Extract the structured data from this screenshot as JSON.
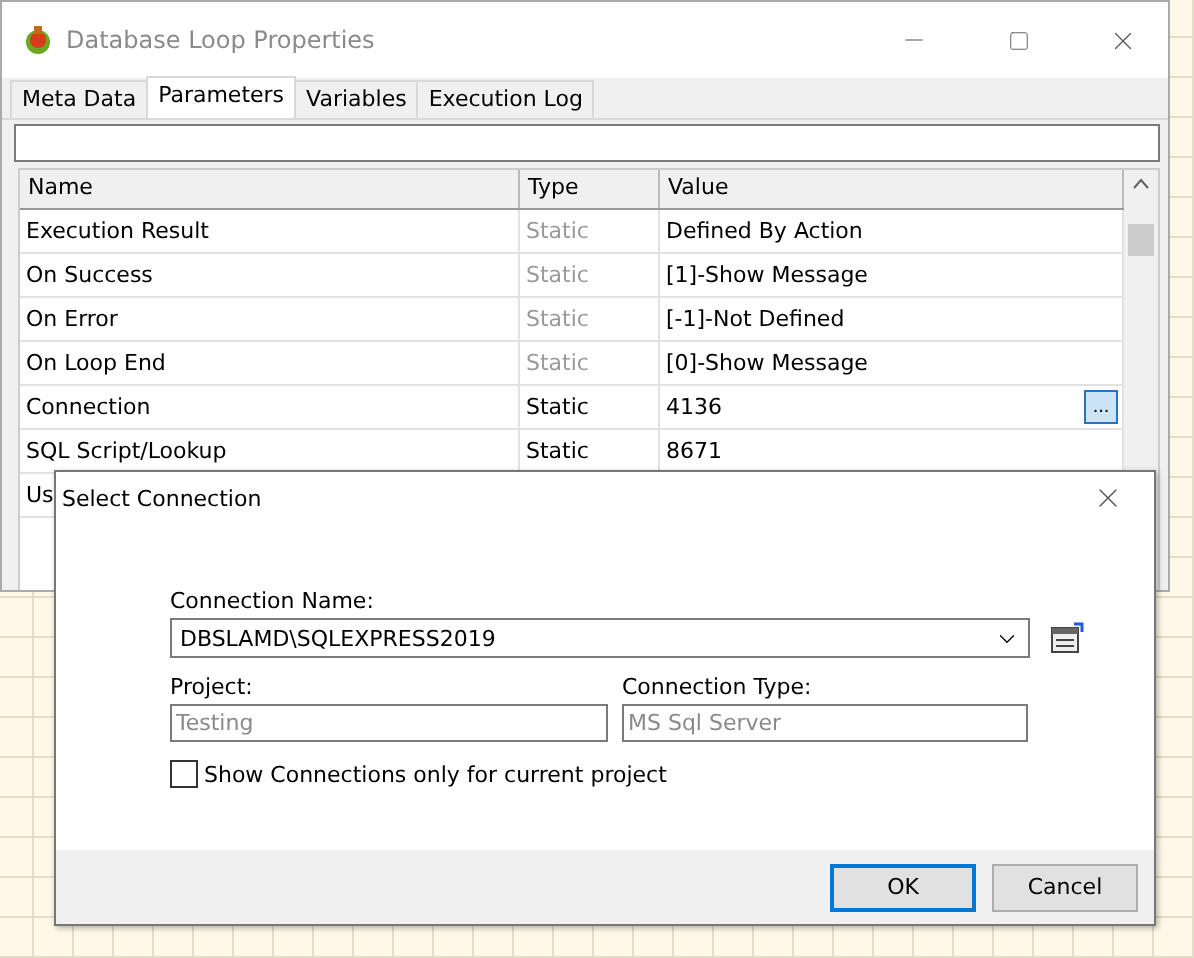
{
  "window": {
    "title": "Database Loop Properties",
    "active": false
  },
  "tabs": [
    {
      "label": "Meta Data",
      "selected": false
    },
    {
      "label": "Parameters",
      "selected": true
    },
    {
      "label": "Variables",
      "selected": false
    },
    {
      "label": "Execution Log",
      "selected": false
    }
  ],
  "table": {
    "columns": [
      "Name",
      "Type",
      "Value"
    ],
    "rows": [
      {
        "name": "Execution Result",
        "type": "Static",
        "value": "Defined By Action",
        "disabled": true
      },
      {
        "name": "On Success",
        "type": "Static",
        "value": "[1]-Show Message",
        "disabled": true
      },
      {
        "name": "On Error",
        "type": "Static",
        "value": "[-1]-Not Defined",
        "disabled": true
      },
      {
        "name": "On Loop End",
        "type": "Static",
        "value": "[0]-Show Message",
        "disabled": true
      },
      {
        "name": "Connection",
        "type": "Static",
        "value": "4136",
        "disabled": false,
        "button": "..."
      },
      {
        "name": "SQL Script/Lookup",
        "type": "Static",
        "value": "8671",
        "disabled": false
      },
      {
        "name": "Us"
      }
    ]
  },
  "dialog": {
    "title": "Select Connection",
    "connection_name": {
      "label": "Connection Name:",
      "value": "DBSLAMD\\SQLEXPRESS2019"
    },
    "project": {
      "label": "Project:",
      "value": "Testing",
      "disabled": true
    },
    "connection_type": {
      "label": "Connection Type:",
      "value": "MS Sql Server",
      "disabled": true
    },
    "checkbox": {
      "label": "Show Connections only for current project",
      "checked": false
    },
    "buttons": [
      {
        "label": "OK",
        "default": true
      },
      {
        "label": "Cancel",
        "default": false
      }
    ]
  }
}
